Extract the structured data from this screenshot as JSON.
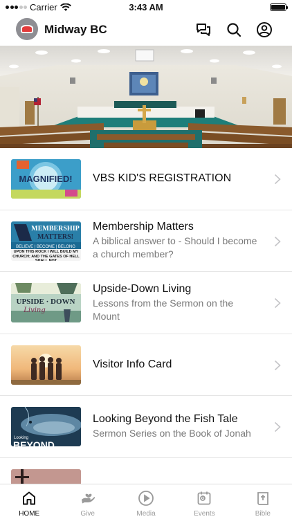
{
  "status_bar": {
    "carrier": "Carrier",
    "time": "3:43 AM",
    "battery_level": 1.0
  },
  "header": {
    "title": "Midway BC",
    "icons": [
      "chat-icon",
      "search-icon",
      "profile-icon"
    ]
  },
  "hero": {
    "image": "church-sanctuary-photo"
  },
  "items": [
    {
      "title": "VBS KID'S REGISTRATION",
      "subtitle": "",
      "thumb": "vbs-magnified-thumbnail"
    },
    {
      "title": "Membership Matters",
      "subtitle": "A biblical answer to - Should I become a church member?",
      "thumb": "membership-matters-thumbnail"
    },
    {
      "title": "Upside-Down Living",
      "subtitle": "Lessons from the Sermon on the Mount",
      "thumb": "upside-down-living-thumbnail"
    },
    {
      "title": "Visitor Info Card",
      "subtitle": "",
      "thumb": "visitor-info-thumbnail"
    },
    {
      "title": "Looking Beyond the Fish Tale",
      "subtitle": "Sermon Series on the Book of Jonah",
      "thumb": "looking-beyond-thumbnail"
    }
  ],
  "thumb_text": {
    "vbs": "MAGNIFIED!",
    "membership_line1": "MEMBERSHIP",
    "membership_line2": "MATTERS!",
    "membership_tagline": "BELIEVE | BECOME | BELONG",
    "membership_verse": "UPON THIS ROCK I WILL BUILD MY CHURCH; AND THE GATES OF HELL SHALL NOT",
    "upside_line1": "UPSIDE · DOWN",
    "upside_line2": "Living",
    "looking_line1": "Looking",
    "looking_line2": "BEYOND"
  },
  "tabs": [
    {
      "label": "HOME",
      "icon": "home-icon",
      "active": true
    },
    {
      "label": "Give",
      "icon": "give-icon",
      "active": false
    },
    {
      "label": "Media",
      "icon": "media-play-icon",
      "active": false
    },
    {
      "label": "Events",
      "icon": "events-calendar-icon",
      "active": false
    },
    {
      "label": "Bible",
      "icon": "bible-icon",
      "active": false
    }
  ],
  "colors": {
    "active_tab": "#111111",
    "inactive_tab": "#9a9a9a",
    "subtitle": "#7a7a7a",
    "divider": "#e5e5e5"
  }
}
